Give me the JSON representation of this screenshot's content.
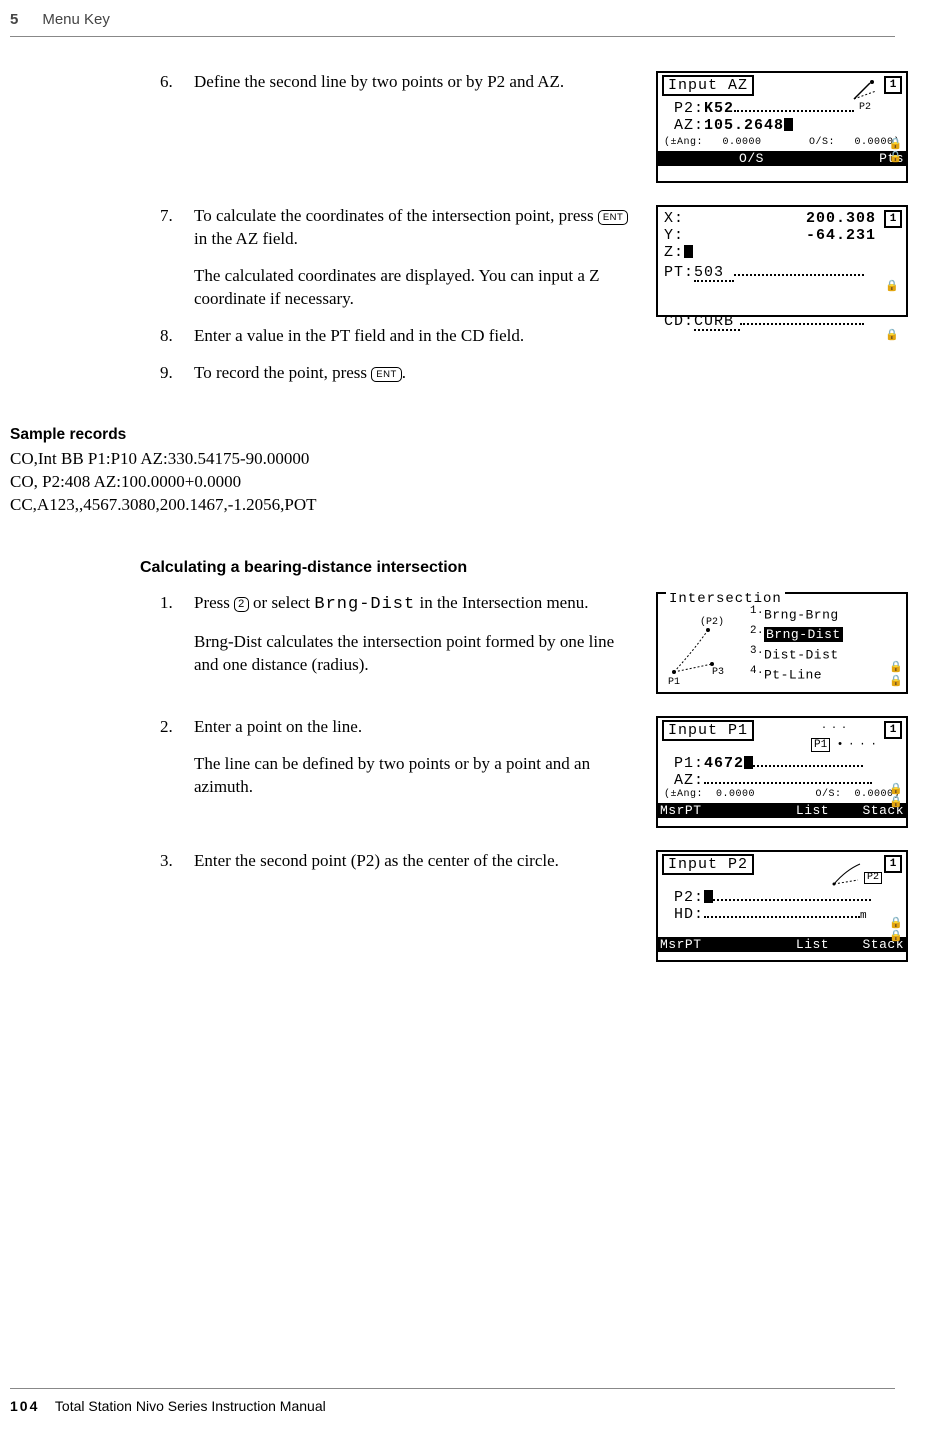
{
  "header": {
    "section_number": "5",
    "section_title": "Menu Key"
  },
  "footer": {
    "page_number": "104",
    "manual_title": "Total Station Nivo Series Instruction Manual"
  },
  "steps_a": {
    "s6": {
      "num": "6.",
      "text": "Define the second line by two points or by P2 and AZ."
    },
    "s7": {
      "num": "7.",
      "text_a": "To calculate the coordinates of the intersection point, press ",
      "text_b": " in the AZ field.",
      "para2": "The calculated coordinates are displayed. You can input a Z coordinate if necessary."
    },
    "s8": {
      "num": "8.",
      "text": "Enter a value in the PT field and in the CD field."
    },
    "s9": {
      "num": "9.",
      "text_a": "To record the point, press ",
      "text_b": "."
    }
  },
  "key_labels": {
    "ent": "ENT",
    "two": "2"
  },
  "screens": {
    "inputAZ": {
      "title": "Input AZ",
      "p2_lab": "P2",
      "p2": "P2:",
      "p2_val": "K52",
      "az": "AZ:",
      "az_val": "105.2648",
      "statusL": "(±Ang:   0.0000",
      "statusR": "O/S:   0.0000)",
      "bar_l": "",
      "bar_c": "O/S",
      "bar_r": "Pts"
    },
    "coords": {
      "x": "X:",
      "x_val": "200.308",
      "y": "Y:",
      "y_val": "-64.231",
      "z": "Z:",
      "pt": "PT:",
      "pt_val": "503",
      "cd": "CD:",
      "cd_val": "CURB"
    },
    "intersection_menu": {
      "title": "Intersection",
      "p2": "(P2)",
      "p3": "P3",
      "p1": "P1",
      "i1": "Brng-Brng",
      "i2": "Brng-Dist",
      "i3": "Dist-Dist",
      "i4": "Pt-Line"
    },
    "inputP1": {
      "title": "Input P1",
      "tag": "P1",
      "p1": "P1:",
      "p1_val": "4672",
      "az": "AZ:",
      "statusL": "(±Ang:  0.0000",
      "statusR": "O/S:  0.0000)",
      "bar_l": "MsrPT",
      "bar_c": "List",
      "bar_r": "Stack"
    },
    "inputP2": {
      "title": "Input P2",
      "tag": "P2",
      "p2": "P2:",
      "hd": "HD:",
      "hd_unit": "m",
      "bar_l": "MsrPT",
      "bar_c": "List",
      "bar_r": "Stack"
    }
  },
  "sample": {
    "heading": "Sample records",
    "l1": "CO,Int BB P1:P10 AZ:330.54175-90.00000",
    "l2": "CO, P2:408 AZ:100.0000+0.0000",
    "l3": "CC,A123,,4567.3080,200.1467,-1.2056,POT"
  },
  "subheading": "Calculating a bearing-distance intersection",
  "steps_b": {
    "s1": {
      "num": "1.",
      "text_a": "Press ",
      "text_b": " or select ",
      "mono": "Brng-Dist",
      "text_c": " in the Intersection menu.",
      "para2": "Brng-Dist calculates the intersection point formed by one line and one distance (radius)."
    },
    "s2": {
      "num": "2.",
      "text": "Enter a point on the line.",
      "para2": "The line can be defined by two points or by a point and an azimuth."
    },
    "s3": {
      "num": "3.",
      "text": "Enter the second point (P2) as the center of the circle."
    }
  }
}
